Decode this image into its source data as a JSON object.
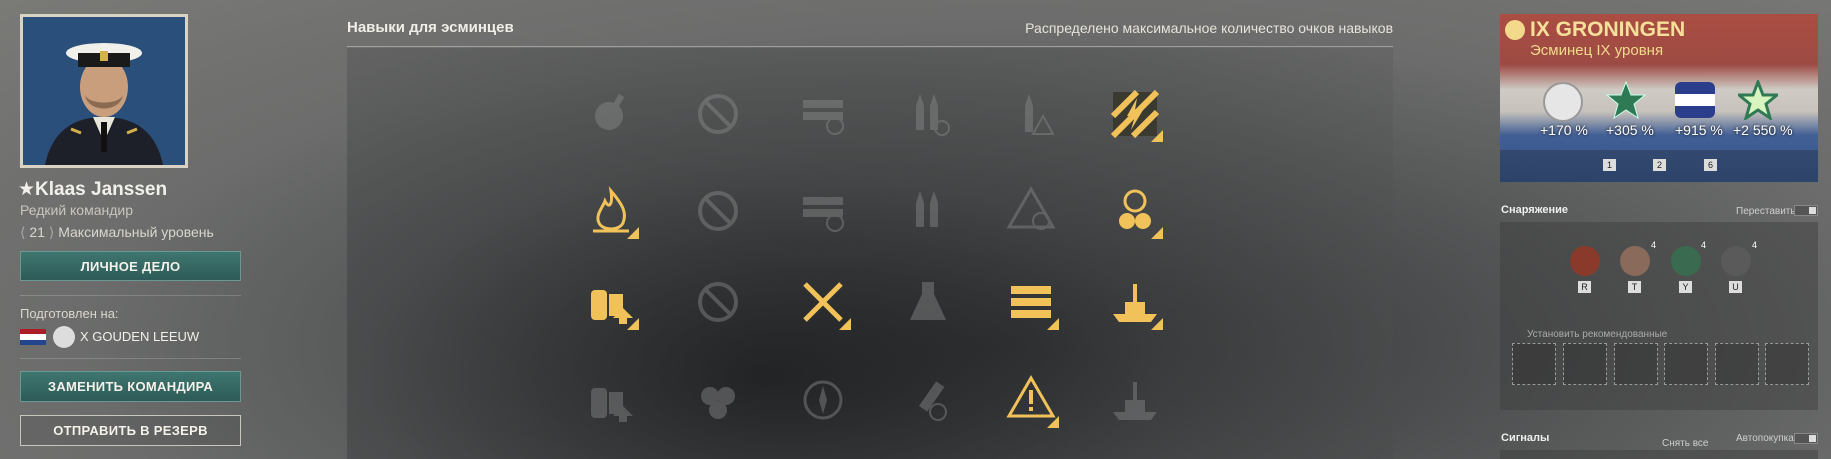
{
  "commander": {
    "name": "★Klaas Janssen",
    "rarity": "Редкий командир",
    "level_number": "21",
    "level_text": "Максимальный уровень",
    "personal_file_button": "ЛИЧНОЕ ДЕЛО",
    "trained_for_label": "Подготовлен на:",
    "trained_ship": "X GOUDEN LEEUW",
    "replace_button": "ЗАМЕНИТЬ КОМАНДИРА",
    "reserve_button": "ОТПРАВИТЬ В РЕЗЕРВ"
  },
  "skills": {
    "title": "Навыки для эсминцев",
    "status": "Распределено максимальное количество очков навыков",
    "rows": [
      [
        "dim",
        "dim",
        "dim",
        "dim",
        "dim",
        "active"
      ],
      [
        "active",
        "dim",
        "dim",
        "dim",
        "dim",
        "active"
      ],
      [
        "active",
        "dim",
        "active",
        "dim",
        "active",
        "active"
      ],
      [
        "dim",
        "dim",
        "dim",
        "dim",
        "active",
        "dim"
      ]
    ],
    "icons": [
      [
        "gear-gun-icon",
        "no-entry-icon",
        "torpedo-rack-icon",
        "shells-reload-icon",
        "shell-warning-icon",
        "lightning-icon"
      ],
      [
        "fire-icon",
        "no-entry-icon",
        "torpedo-rack-icon",
        "shells-icon",
        "warning-target-icon",
        "rudder-propeller-icon"
      ],
      [
        "engine-boost-icon",
        "no-entry-icon",
        "crossed-torpedoes-icon",
        "flask-icon",
        "torpedo-tubes-icon",
        "warship-icon"
      ],
      [
        "engine-boost-icon",
        "propeller-boost-icon",
        "compass-icon",
        "gun-reload-icon",
        "warning-down-icon",
        "ship-silhouette-icon"
      ]
    ]
  },
  "ship": {
    "name": "IX GRONINGEN",
    "class": "Эсминец IX уровня",
    "bonuses": [
      "+170 %",
      "+305 %",
      "+915 %",
      "+2 550 %"
    ],
    "slot_keys": [
      "1",
      "2",
      "6"
    ]
  },
  "equipment": {
    "title": "Снаряжение",
    "rearrange_label": "Переставить",
    "consumables": [
      {
        "key": "R",
        "count": ""
      },
      {
        "key": "T",
        "count": "4"
      },
      {
        "key": "Y",
        "count": "4"
      },
      {
        "key": "U",
        "count": "4"
      }
    ],
    "recommended_label": "Установить рекомендованные"
  },
  "signals": {
    "title": "Сигналы",
    "clear_all": "Снять все",
    "autobuy_label": "Автопокупка"
  },
  "colors": {
    "accent_green": "#3f7670",
    "skill_active": "#f2c25a",
    "skill_dim": "#8a8a8a"
  }
}
